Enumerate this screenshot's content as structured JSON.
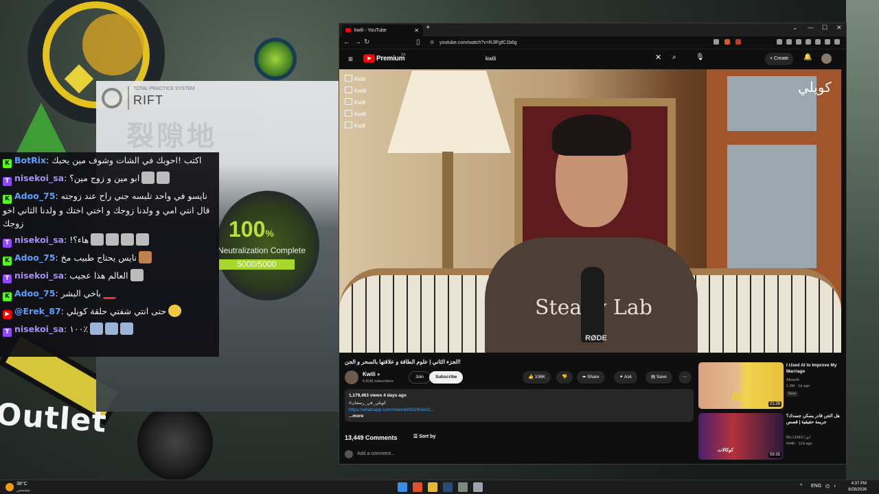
{
  "game": {
    "rift_small": "TOTAL PRACTICE SYSTEM",
    "rift_title": "RIFT",
    "rift_cjk": "裂隙地",
    "gauge_percent": "100",
    "gauge_percent_unit": "%",
    "gauge_label": "Neutralization Complete",
    "gauge_progress": "5000/5000",
    "outlet_text": "Outlet"
  },
  "chat": {
    "messages": [
      {
        "platform": "kick",
        "platform_glyph": "K",
        "user": "BotRix",
        "text": "اكتب !احوبك في الشات وشوف مين يحبك",
        "user_color": "#5aa0ff"
      },
      {
        "platform": "twitch",
        "platform_glyph": "T",
        "user": "nisekoi_sa",
        "text": "ابو مين و زوج مين؟",
        "user_color": "#a88ff5"
      },
      {
        "platform": "kick",
        "platform_glyph": "K",
        "user": "Adoo_75",
        "text": "نايسو في واحد تلبسه جني راح عند زوجته قال انتي امي و ولدنا زوجك و اختي اختك و ولدنا الثاني اخو زوجك",
        "user_color": "#5aa0ff"
      },
      {
        "platform": "twitch",
        "platform_glyph": "T",
        "user": "nisekoi_sa",
        "text": "!هاء؟",
        "user_color": "#a88ff5"
      },
      {
        "platform": "kick",
        "platform_glyph": "K",
        "user": "Adoo_75",
        "text": "نايس يحتاج طبيب مخ",
        "user_color": "#5aa0ff"
      },
      {
        "platform": "twitch",
        "platform_glyph": "T",
        "user": "nisekoi_sa",
        "text": "العالم هذا عجيب",
        "user_color": "#a88ff5"
      },
      {
        "platform": "kick",
        "platform_glyph": "K",
        "user": "Adoo_75",
        "text": "باخي البشر",
        "user_color": "#5aa0ff"
      },
      {
        "platform": "yt",
        "platform_glyph": "▶",
        "user": "@Erek_87",
        "text": "حتى انتي شفتي حلقة كويلي",
        "user_color": "#5aa0ff"
      },
      {
        "platform": "twitch",
        "platform_glyph": "T",
        "user": "nisekoi_sa",
        "text": "١٠٠٪",
        "user_color": "#a88ff5"
      }
    ]
  },
  "browser": {
    "tab_title": "kwili - YouTube",
    "url": "youtube.com/watch?v=RJlFgfC1b6g",
    "youtube": {
      "premium_label": "Premium",
      "region": "SA",
      "search_value": "kwili",
      "create_label": "Create",
      "socials": [
        "Kwili",
        "Kwtil",
        "Kwili",
        "Kwtil",
        "Kwili"
      ],
      "watermark": "كويلي",
      "shirt_text": "Steady Lab",
      "mic_brand": "RØDE",
      "video_title": "الجزء الثاني | علوم الطاقة و علاقتها بالسحر و الجن!",
      "channel_name": "Kwili",
      "subscribers": "6.81M subscribers",
      "join_label": "Join",
      "subscribe_label": "Subscribe",
      "likes": "106K",
      "share_label": "Share",
      "ask_label": "Ask",
      "save_label": "Save",
      "views_line": "1,179,463 views  4 days ago",
      "desc_line": "#كويلي_في_رمضان",
      "desc_link": "https://whatsapp.com/channel/0029VanO...",
      "more_label": "...more",
      "comments_count": "13,449 Comments",
      "sort_label": "Sort by",
      "add_comment": "Add a comment...",
      "recommendations": [
        {
          "title": "I Used AI to Improve My Marriage",
          "channel": "Abuyob",
          "meta": "1.9M · 1d ago",
          "badge": "New",
          "duration": "21:28",
          "thumb_text": "Ai"
        },
        {
          "title": "هل الجن قادر يسكن جسدك؟ جريمة حقيقية | قصص",
          "channel": "Mo LEMO | ابو",
          "meta": "644K · 12d ago",
          "badge": "",
          "duration": "59:35",
          "thumb_text": "كوكالات"
        }
      ]
    }
  },
  "taskbar": {
    "temp": "38°C",
    "condition": "مشمس",
    "lang": "ENG",
    "time": "4:37 PM",
    "date": "8/28/2026"
  }
}
